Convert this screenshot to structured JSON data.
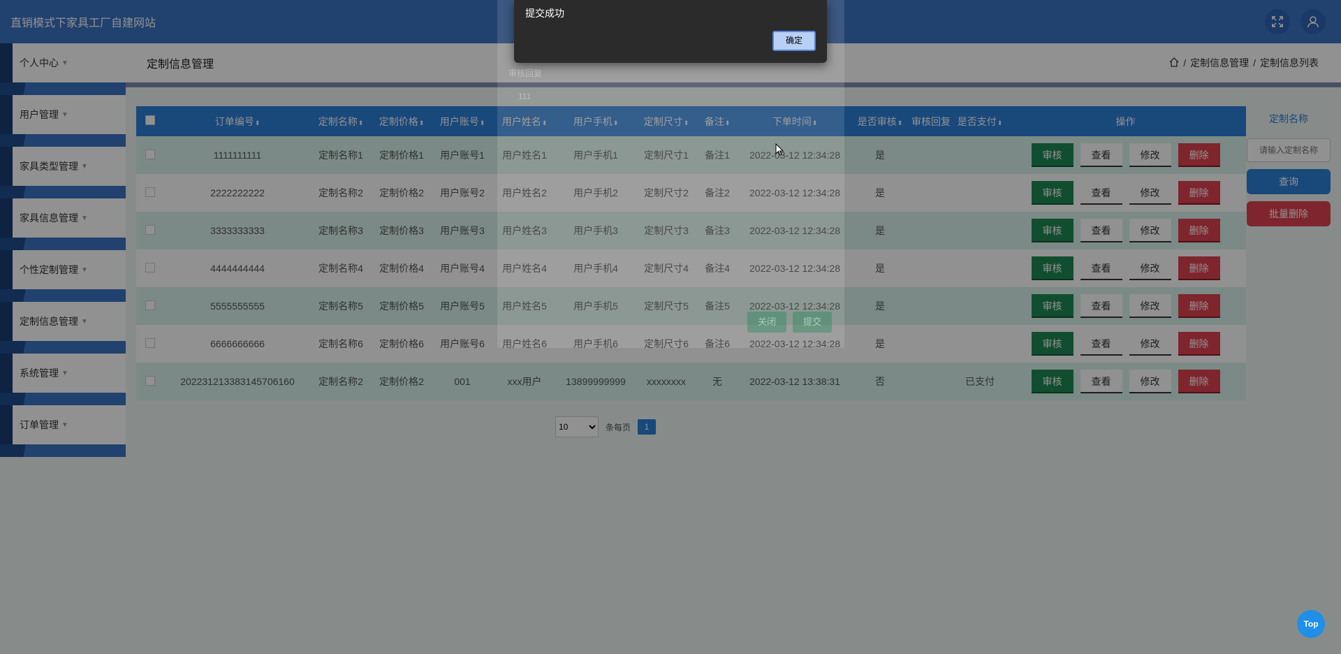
{
  "header": {
    "site_title": "直销模式下家具工厂自建网站"
  },
  "sidebar": {
    "items": [
      {
        "label": "个人中心"
      },
      {
        "label": "用户管理"
      },
      {
        "label": "家具类型管理"
      },
      {
        "label": "家具信息管理"
      },
      {
        "label": "个性定制管理"
      },
      {
        "label": "定制信息管理"
      },
      {
        "label": "系统管理"
      },
      {
        "label": "订单管理"
      }
    ]
  },
  "main": {
    "page_title": "定制信息管理",
    "breadcrumb": [
      "定制信息管理",
      "定制信息列表"
    ]
  },
  "table": {
    "headers": [
      "订单编号",
      "定制名称",
      "定制价格",
      "用户账号",
      "用户姓名",
      "用户手机",
      "定制尺寸",
      "备注",
      "下单时间",
      "是否审核",
      "审核回复",
      "是否支付",
      "操作"
    ],
    "rows": [
      {
        "order_no": "1111111111",
        "name": "定制名称1",
        "price": "定制价格1",
        "account": "用户账号1",
        "username": "用户姓名1",
        "phone": "用户手机1",
        "size": "定制尺寸1",
        "note": "备注1",
        "time": "2022-03-12 12:34:28",
        "audited": "是",
        "reply": "",
        "paid": ""
      },
      {
        "order_no": "2222222222",
        "name": "定制名称2",
        "price": "定制价格2",
        "account": "用户账号2",
        "username": "用户姓名2",
        "phone": "用户手机2",
        "size": "定制尺寸2",
        "note": "备注2",
        "time": "2022-03-12 12:34:28",
        "audited": "是",
        "reply": "",
        "paid": ""
      },
      {
        "order_no": "3333333333",
        "name": "定制名称3",
        "price": "定制价格3",
        "account": "用户账号3",
        "username": "用户姓名3",
        "phone": "用户手机3",
        "size": "定制尺寸3",
        "note": "备注3",
        "time": "2022-03-12 12:34:28",
        "audited": "是",
        "reply": "",
        "paid": ""
      },
      {
        "order_no": "4444444444",
        "name": "定制名称4",
        "price": "定制价格4",
        "account": "用户账号4",
        "username": "用户姓名4",
        "phone": "用户手机4",
        "size": "定制尺寸4",
        "note": "备注4",
        "time": "2022-03-12 12:34:28",
        "audited": "是",
        "reply": "",
        "paid": ""
      },
      {
        "order_no": "5555555555",
        "name": "定制名称5",
        "price": "定制价格5",
        "account": "用户账号5",
        "username": "用户姓名5",
        "phone": "用户手机5",
        "size": "定制尺寸5",
        "note": "备注5",
        "time": "2022-03-12 12:34:28",
        "audited": "是",
        "reply": "",
        "paid": ""
      },
      {
        "order_no": "6666666666",
        "name": "定制名称6",
        "price": "定制价格6",
        "account": "用户账号6",
        "username": "用户姓名6",
        "phone": "用户手机6",
        "size": "定制尺寸6",
        "note": "备注6",
        "time": "2022-03-12 12:34:28",
        "audited": "是",
        "reply": "",
        "paid": ""
      },
      {
        "order_no": "202231213383145706160",
        "name": "定制名称2",
        "price": "定制价格2",
        "account": "001",
        "username": "xxx用户",
        "phone": "13899999999",
        "size": "xxxxxxxx",
        "note": "无",
        "time": "2022-03-12 13:38:31",
        "audited": "否",
        "reply": "",
        "paid": "已支付"
      }
    ],
    "actions": {
      "audit": "审核",
      "view": "查看",
      "edit": "修改",
      "delete": "删除"
    }
  },
  "pager": {
    "page_size": "10",
    "page_size_options": [
      "10"
    ],
    "per_page_label": "条每页",
    "current_page": "1"
  },
  "search": {
    "label": "定制名称",
    "placeholder": "请输入定制名称",
    "query_button": "查询",
    "batch_delete_button": "批量删除"
  },
  "background_dialog": {
    "field_label": "审核回复",
    "field_value": "111",
    "close_label": "关闭",
    "submit_label": "提交"
  },
  "alert": {
    "message": "提交成功",
    "ok_label": "确定"
  },
  "top_button": "Top",
  "colors": {
    "primary": "#2d7fd9",
    "header": "#3b72c4",
    "audit": "#1e8a55",
    "danger": "#e0424f"
  }
}
